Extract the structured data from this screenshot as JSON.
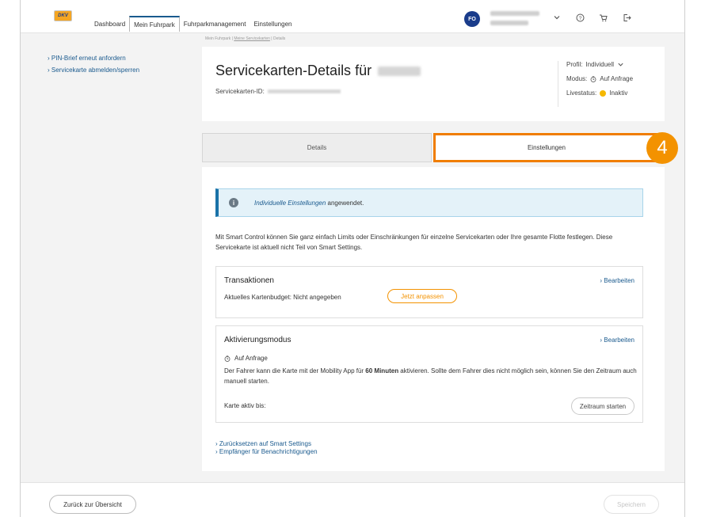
{
  "header": {
    "logo_text": "DKV",
    "nav": [
      "Dashboard",
      "Mein Fuhrpark",
      "Fuhrparkmanagement",
      "Einstellungen"
    ],
    "avatar_initials": "FO",
    "icons": [
      "chevron-down-icon",
      "help-icon",
      "cart-icon",
      "logout-icon"
    ]
  },
  "breadcrumb": {
    "root": "Mein Fuhrpark",
    "middle": "Meine Servicekarten",
    "current": "Details"
  },
  "sidebar": {
    "items": [
      "› PIN-Brief erneut anfordern",
      "› Servicekarte abmelden/sperren"
    ]
  },
  "title_card": {
    "title": "Servicekarten-Details für",
    "id_label": "Servicekarten-ID:",
    "profile_label": "Profil:",
    "profile_value": "Individuell",
    "mode_label": "Modus:",
    "mode_value": "Auf Anfrage",
    "live_label": "Livestatus:",
    "live_value": "Inaktiv",
    "live_color": "#f5b800"
  },
  "tabs": {
    "details": "Details",
    "settings": "Einstellungen"
  },
  "step_badge": "4",
  "info": {
    "link": "Individuelle Einstellungen",
    "text": "angewendet."
  },
  "intro": "Mit Smart Control können Sie ganz einfach Limits oder Einschränkungen für einzelne Servicekarten oder Ihre gesamte Flotte festlegen. Diese Servicekarte ist aktuell nicht Teil von Smart Settings.",
  "transactions": {
    "title": "Transaktionen",
    "edit": "› Bearbeiten",
    "budget_label": "Aktuelles Kartenbudget: Nicht angegeben",
    "adjust_button": "Jetzt anpassen"
  },
  "activation": {
    "title": "Aktivierungsmodus",
    "edit": "› Bearbeiten",
    "mode": "Auf Anfrage",
    "desc_before": "Der Fahrer kann die Karte mit der Mobility App für ",
    "desc_bold": "60 Minuten",
    "desc_after": " aktivieren. Sollte dem Fahrer dies nicht möglich sein, können Sie den Zeitraum auch manuell starten.",
    "active_until_label": "Karte aktiv bis:",
    "start_button": "Zeitraum starten"
  },
  "links": [
    "› Zurücksetzen auf Smart Settings",
    "› Empfänger für Benachrichtigungen"
  ],
  "footer": {
    "back_button": "Zurück zur Übersicht",
    "save_button": "Speichern"
  },
  "colors": {
    "accent": "#f39200",
    "brand": "#1a3c8b",
    "link": "#1a5a8e",
    "info_bg": "#e4f2f9"
  }
}
